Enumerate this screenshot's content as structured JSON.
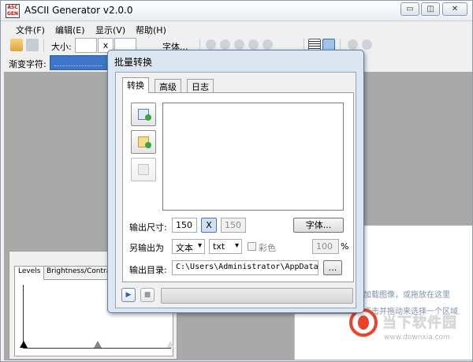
{
  "app": {
    "title": "ASCII Generator v2.0.0",
    "icon_text": "ASC GEN"
  },
  "window_controls": {
    "minimize": "▭",
    "restore": "◫",
    "close": "✕"
  },
  "menu": [
    "文件(F)",
    "编辑(E)",
    "显示(V)",
    "帮助(H)"
  ],
  "toolbar": {
    "size_label": "大小:",
    "size_x": "x",
    "font_label": "字体..."
  },
  "gradient": {
    "label": "渐变字符:"
  },
  "dialog": {
    "title": "批量转换",
    "tabs": [
      "转换",
      "高级",
      "日志"
    ],
    "output_size_label": "输出尺寸:",
    "width": "150",
    "lock_label": "X",
    "height": "150",
    "font_button": "字体...",
    "save_as_label": "另输出为",
    "format": "文本",
    "extension": "txt",
    "color_label": "彩色",
    "percent_value": "100",
    "percent_sign": "%",
    "output_dir_label": "输出目录:",
    "output_dir": "C:\\Users\\Administrator\\AppData\\Local",
    "browse_button": "..."
  },
  "levels_panel": {
    "tabs": [
      "Levels",
      "Brightness/Contrast"
    ]
  },
  "hints": {
    "line1": "加载图像，或拖放在这里",
    "line2": "点击并拖动来选择一个区域"
  },
  "watermark": {
    "name": "当下软件园",
    "url": "www.downxia.com"
  },
  "colors": {
    "accent": "#3d76c9",
    "logo_red": "#e8442d",
    "workspace": "#a9a9a9"
  }
}
